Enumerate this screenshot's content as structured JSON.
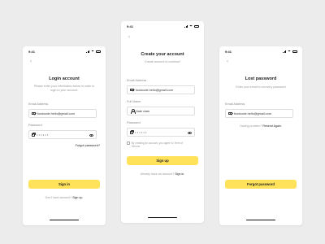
{
  "accent_color": "#FFE25A",
  "status_time": "9:41",
  "back_glyph": "‹",
  "login": {
    "title": "Login account",
    "subtitle": "Please enter your information below in order to login to your account.",
    "email_label": "Email Address",
    "email_value": "foodcode.hello@gmail.com",
    "password_label": "Password",
    "password_mask": "••••••",
    "forgot_link": "Forgot password?",
    "submit_label": "Sign in",
    "footer_text": "Don't have account?",
    "footer_link": "Sign up."
  },
  "signup": {
    "title": "Create your account",
    "subtitle": "Create account to continue!",
    "email_label": "Email Address",
    "email_value": "foodcode.hello@gmail.com",
    "name_label": "Full Name",
    "name_value": "Nate clark",
    "password_label": "Password",
    "password_mask": "••••••",
    "terms_text": "By creating an account, you agree to Term of Service",
    "submit_label": "Sign up",
    "footer_text": "Already have an account?",
    "footer_link": "Sign in."
  },
  "lost": {
    "title": "Lost password",
    "subtitle": "Enter your email to recovery password",
    "email_value": "foodcode.hello@gmail.com",
    "help_text": "Having problem?",
    "help_link": "Resend Again.",
    "submit_label": "Forgot password"
  }
}
